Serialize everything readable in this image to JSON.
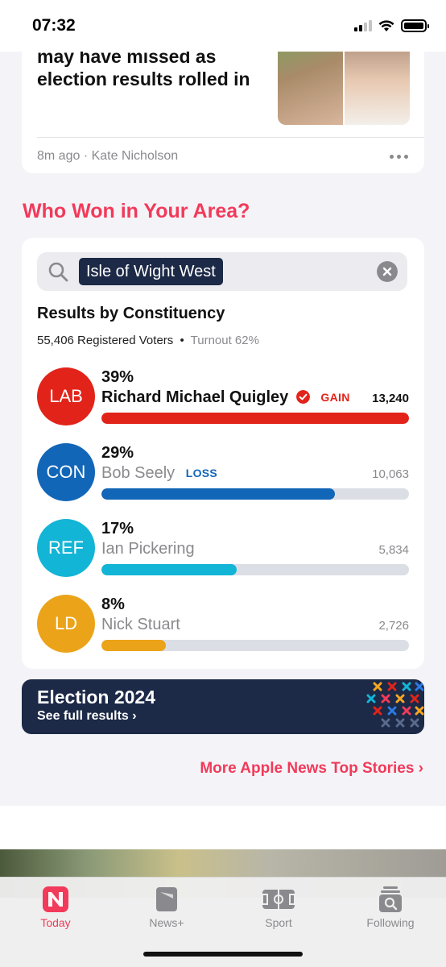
{
  "status_bar": {
    "time": "07:32"
  },
  "article": {
    "headline": "may have missed as election results rolled in",
    "meta": "8m ago · Kate Nicholson"
  },
  "section_title": "Who Won in Your Area?",
  "results": {
    "search_value": "Isle of Wight West",
    "heading": "Results by Constituency",
    "registered_voters": "55,406 Registered Voters",
    "separator": "•",
    "turnout": "Turnout 62%",
    "candidates": [
      {
        "party": "LAB",
        "pct": "39%",
        "name": "Richard Michael Quigley",
        "tag": "GAIN",
        "votes": "13,240",
        "share": 1.0,
        "color": "#e2231a",
        "winner": true
      },
      {
        "party": "CON",
        "pct": "29%",
        "name": "Bob Seely",
        "tag": "LOSS",
        "votes": "10,063",
        "share": 0.76,
        "color": "#1266b8",
        "winner": false
      },
      {
        "party": "REF",
        "pct": "17%",
        "name": "Ian Pickering",
        "tag": "",
        "votes": "5,834",
        "share": 0.44,
        "color": "#13b5d6",
        "winner": false
      },
      {
        "party": "LD",
        "pct": "8%",
        "name": "Nick Stuart",
        "tag": "",
        "votes": "2,726",
        "share": 0.21,
        "color": "#eba419",
        "winner": false
      }
    ]
  },
  "banner": {
    "title": "Election 2024",
    "link": "See full results ›"
  },
  "more_link": "More Apple News Top Stories ›",
  "tabs": [
    {
      "label": "Today",
      "active": true
    },
    {
      "label": "News+",
      "active": false
    },
    {
      "label": "Sport",
      "active": false
    },
    {
      "label": "Following",
      "active": false
    }
  ],
  "colors": {
    "accent": "#f23a5a",
    "navy": "#1c2947",
    "gain": "#e2231a",
    "loss": "#1266b8"
  }
}
